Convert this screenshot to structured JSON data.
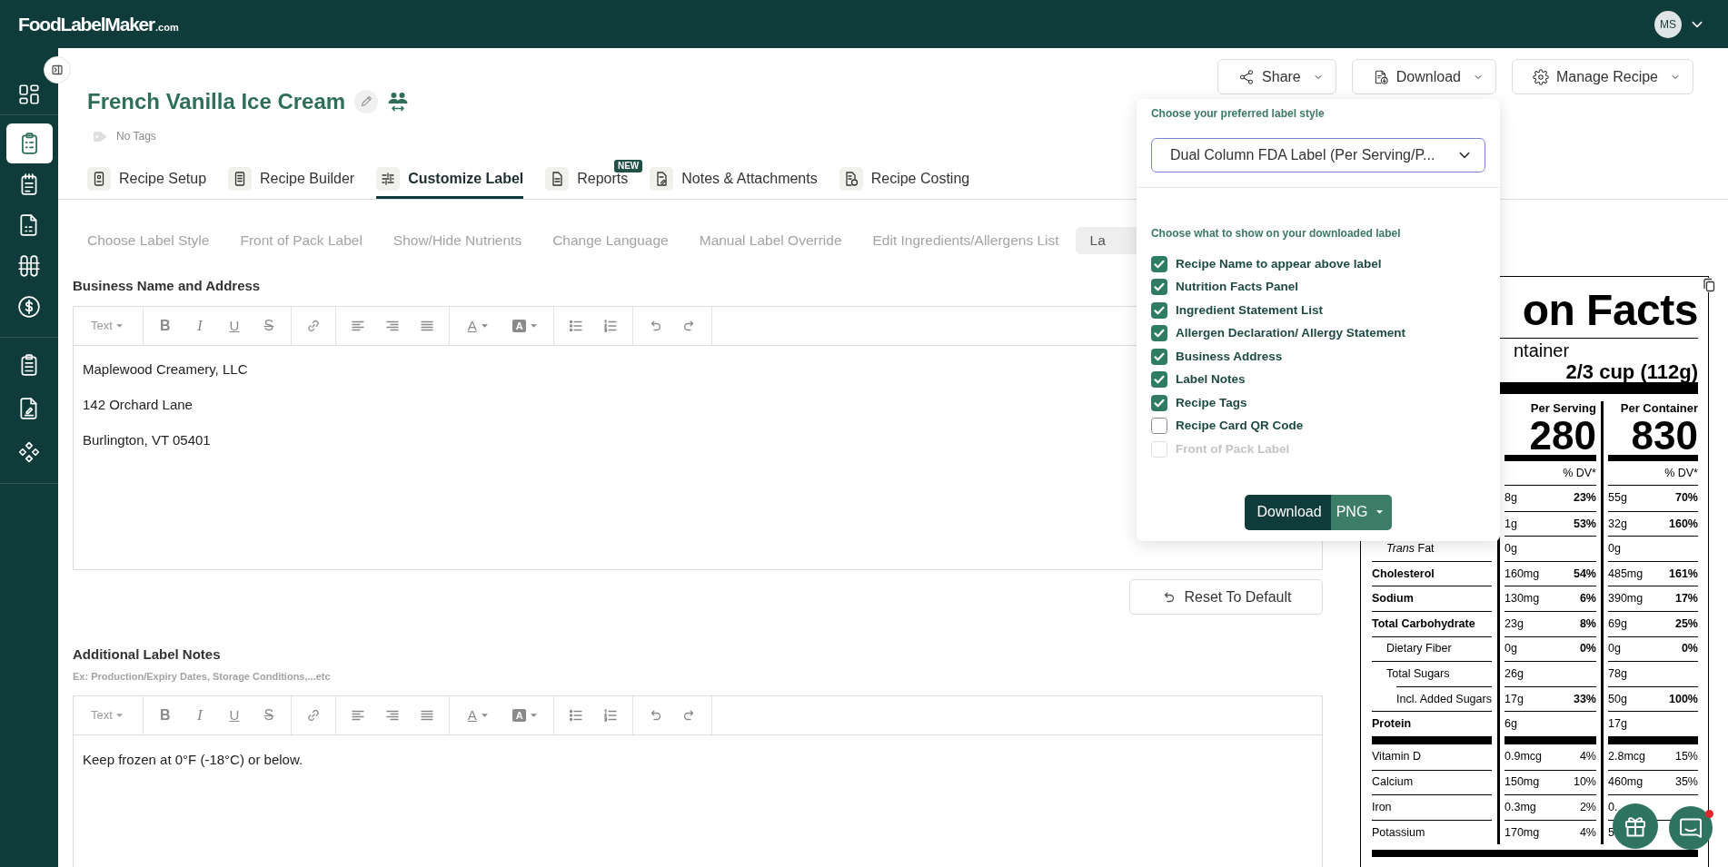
{
  "header": {
    "logo": "FoodLabelMaker",
    "logo_suffix": ".com",
    "avatar": "MS"
  },
  "sidebar": {
    "groups": [
      [
        {
          "kind": "dashboard",
          "selected": false
        }
      ],
      [
        {
          "kind": "clipboard",
          "selected": true
        },
        {
          "kind": "notepad",
          "selected": false
        },
        {
          "kind": "document",
          "selected": false
        },
        {
          "kind": "columns",
          "selected": false
        },
        {
          "kind": "dollar",
          "selected": false
        }
      ],
      [
        {
          "kind": "clipboard-list",
          "selected": false
        },
        {
          "kind": "document-edit",
          "selected": false
        },
        {
          "kind": "diamonds",
          "selected": false
        }
      ]
    ]
  },
  "recipe": {
    "title": "French Vanilla Ice Cream",
    "tags": "No Tags"
  },
  "actions": [
    {
      "kind": "share",
      "label": "Share"
    },
    {
      "kind": "download",
      "label": "Download"
    },
    {
      "kind": "manage",
      "label": "Manage Recipe"
    }
  ],
  "tabs": [
    {
      "kind": "setup",
      "label": "Recipe Setup",
      "selected": false
    },
    {
      "kind": "builder",
      "label": "Recipe Builder",
      "selected": false
    },
    {
      "kind": "customize",
      "label": "Customize Label",
      "selected": true
    },
    {
      "kind": "reports",
      "label": "Reports",
      "selected": false,
      "badge": "NEW"
    },
    {
      "kind": "notes",
      "label": "Notes & Attachments",
      "selected": false
    },
    {
      "kind": "costing",
      "label": "Recipe Costing",
      "selected": false
    }
  ],
  "subtabs": [
    {
      "label": "Choose Label Style",
      "selected": false
    },
    {
      "label": "Front of Pack Label",
      "selected": false
    },
    {
      "label": "Show/Hide Nutrients",
      "selected": false
    },
    {
      "label": "Change Language",
      "selected": false
    },
    {
      "label": "Manual Label Override",
      "selected": false
    },
    {
      "label": "Edit Ingredients/Allergens List",
      "selected": false
    },
    {
      "label": "La",
      "selected": true
    }
  ],
  "business_editor": {
    "label": "Business Name and Address",
    "toolbar": [
      [
        {
          "kind": "heading",
          "label": "Text"
        }
      ],
      [
        {
          "kind": "bold",
          "glyph": "B"
        },
        {
          "kind": "italic",
          "glyph": "I"
        },
        {
          "kind": "underline",
          "glyph": "U"
        },
        {
          "kind": "strike",
          "glyph": "S"
        }
      ],
      [
        {
          "kind": "link"
        }
      ],
      [
        {
          "kind": "align-left"
        },
        {
          "kind": "align-right"
        },
        {
          "kind": "justify"
        }
      ],
      [
        {
          "kind": "font-color",
          "glyph": "A"
        },
        {
          "kind": "highlight",
          "glyph": "A"
        }
      ],
      [
        {
          "kind": "bullets"
        },
        {
          "kind": "numbers"
        }
      ],
      [
        {
          "kind": "undo"
        },
        {
          "kind": "redo"
        }
      ]
    ],
    "paragraphs": [
      "Maplewood Creamery, LLC",
      "142 Orchard Lane",
      "Burlington, VT 05401"
    ]
  },
  "reset_button": "Reset To Default",
  "notes_editor": {
    "label": "Additional Label Notes",
    "hint": "Ex: Production/Expiry Dates, Storage Conditions,...etc",
    "toolbar": [
      [
        {
          "kind": "heading",
          "label": "Text"
        }
      ],
      [
        {
          "kind": "bold",
          "glyph": "B"
        },
        {
          "kind": "italic",
          "glyph": "I"
        },
        {
          "kind": "underline",
          "glyph": "U"
        },
        {
          "kind": "strike",
          "glyph": "S"
        }
      ],
      [
        {
          "kind": "link"
        }
      ],
      [
        {
          "kind": "align-left"
        },
        {
          "kind": "align-right"
        },
        {
          "kind": "justify"
        }
      ],
      [
        {
          "kind": "font-color",
          "glyph": "A"
        },
        {
          "kind": "highlight",
          "glyph": "A"
        }
      ],
      [
        {
          "kind": "bullets"
        },
        {
          "kind": "numbers"
        }
      ],
      [
        {
          "kind": "undo"
        },
        {
          "kind": "redo"
        }
      ]
    ],
    "paragraphs": [
      "Keep frozen at 0°F (-18°C) or below."
    ]
  },
  "download_menu": {
    "style_heading": "Choose your preferred label style",
    "style_value": "Dual Column FDA Label (Per Serving/P...",
    "options_heading": "Choose what to show on your downloaded label",
    "options": [
      {
        "label": "Recipe Name to appear above label",
        "checked": true,
        "disabled": false
      },
      {
        "label": "Nutrition Facts Panel",
        "checked": true,
        "disabled": false
      },
      {
        "label": "Ingredient Statement List",
        "checked": true,
        "disabled": false
      },
      {
        "label": "Allergen Declaration/ Allergy Statement",
        "checked": true,
        "disabled": false
      },
      {
        "label": "Business Address",
        "checked": true,
        "disabled": false
      },
      {
        "label": "Label Notes",
        "checked": true,
        "disabled": false
      },
      {
        "label": "Recipe Tags",
        "checked": true,
        "disabled": false
      },
      {
        "label": "Recipe Card QR Code",
        "checked": false,
        "disabled": false
      },
      {
        "label": "Front of Pack Label",
        "checked": false,
        "disabled": true
      }
    ],
    "button": "Download",
    "format": "PNG"
  },
  "nutrition_label": {
    "title": "on Facts",
    "servings": "ntainer",
    "serving_size": "2/3 cup (112g)",
    "columns": [
      {
        "header": "Per Serving",
        "calories": "280",
        "dv_header": "% DV*"
      },
      {
        "header": "Per Container",
        "calories": "830",
        "dv_header": "% DV*"
      }
    ],
    "nutrients": [
      {
        "values": [
          {
            "amount": "8g",
            "dv": "23%"
          },
          {
            "amount": "55g",
            "dv": "70%"
          }
        ]
      },
      {
        "values": [
          {
            "amount": "1g",
            "dv": "53%"
          },
          {
            "amount": "32g",
            "dv": "160%"
          }
        ]
      },
      {
        "label": "*Trans* Fat",
        "kind": "sub",
        "values": [
          {
            "amount": "0g"
          },
          {
            "amount": "0g"
          }
        ]
      },
      {
        "label": "Cholesterol",
        "kind": "main",
        "values": [
          {
            "amount": "160mg",
            "dv": "54%"
          },
          {
            "amount": "485mg",
            "dv": "161%"
          }
        ]
      },
      {
        "label": "Sodium",
        "kind": "main",
        "values": [
          {
            "amount": "130mg",
            "dv": "6%"
          },
          {
            "amount": "390mg",
            "dv": "17%"
          }
        ]
      },
      {
        "label": "Total Carbohydrate",
        "kind": "main",
        "values": [
          {
            "amount": "23g",
            "dv": "8%"
          },
          {
            "amount": "69g",
            "dv": "25%"
          }
        ]
      },
      {
        "label": "Dietary Fiber",
        "kind": "sub",
        "values": [
          {
            "amount": "0g",
            "dv": "0%"
          },
          {
            "amount": "0g",
            "dv": "0%"
          }
        ]
      },
      {
        "label": "Total Sugars",
        "kind": "sub",
        "values": [
          {
            "amount": "26g"
          },
          {
            "amount": "78g"
          }
        ]
      },
      {
        "label": "Incl. Added Sugars",
        "kind": "added",
        "values": [
          {
            "amount": "17g",
            "dv": "33%"
          },
          {
            "amount": "50g",
            "dv": "100%"
          }
        ]
      },
      {
        "label": "Protein",
        "kind": "main",
        "values": [
          {
            "amount": "6g"
          },
          {
            "amount": "17g"
          }
        ]
      }
    ],
    "vitamins": [
      {
        "label": "Vitamin D",
        "values": [
          {
            "amount": "0.9mcg",
            "dv": "4%"
          },
          {
            "amount": "2.8mcg",
            "dv": "15%"
          }
        ]
      },
      {
        "label": "Calcium",
        "values": [
          {
            "amount": "150mg",
            "dv": "10%"
          },
          {
            "amount": "460mg",
            "dv": "35%"
          }
        ]
      },
      {
        "label": "Iron",
        "values": [
          {
            "amount": "0.3mg",
            "dv": "2%"
          },
          {
            "amount": "0."
          }
        ]
      },
      {
        "label": "Potassium",
        "values": [
          {
            "amount": "170mg",
            "dv": "4%"
          },
          {
            "amount": "5"
          }
        ]
      }
    ]
  }
}
